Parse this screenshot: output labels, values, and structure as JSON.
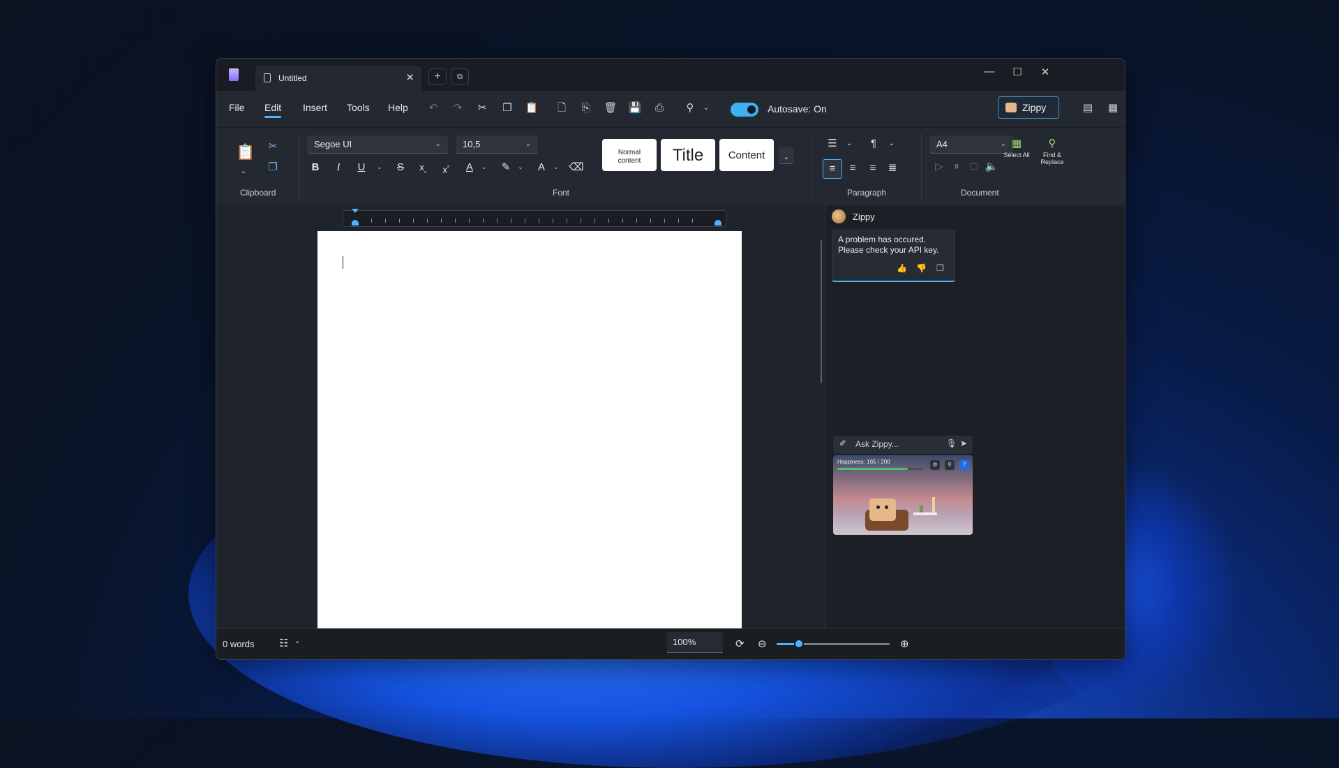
{
  "window": {
    "tab_title": "Untitled"
  },
  "menu": {
    "items": [
      "File",
      "Edit",
      "Insert",
      "Tools",
      "Help"
    ],
    "active": "Edit"
  },
  "toolbar": {
    "autosave_label": "Autosave: On",
    "autosave_on": true,
    "zippy_button": "Zippy"
  },
  "ribbon": {
    "clipboard_label": "Clipboard",
    "font_label": "Font",
    "paragraph_label": "Paragraph",
    "document_label": "Document",
    "font_family": "Segoe UI",
    "font_size": "10,5",
    "styles": {
      "normal": "Normal content",
      "title": "Title",
      "content": "Content"
    },
    "page_size": "A4",
    "select_all": "Select All",
    "find_replace": "Find & Replace"
  },
  "assistant": {
    "name": "Zippy",
    "message": "A problem has occured. Please check your API key.",
    "ask_placeholder": "Ask Zippy...",
    "happiness_label": "Happiness: 165 / 200",
    "happiness_value": 165,
    "happiness_max": 200
  },
  "status": {
    "word_count": "0 words",
    "zoom": "100%",
    "zoom_level": 0.2
  },
  "colors": {
    "accent": "#4fb3ff",
    "background": "#1f232b"
  }
}
